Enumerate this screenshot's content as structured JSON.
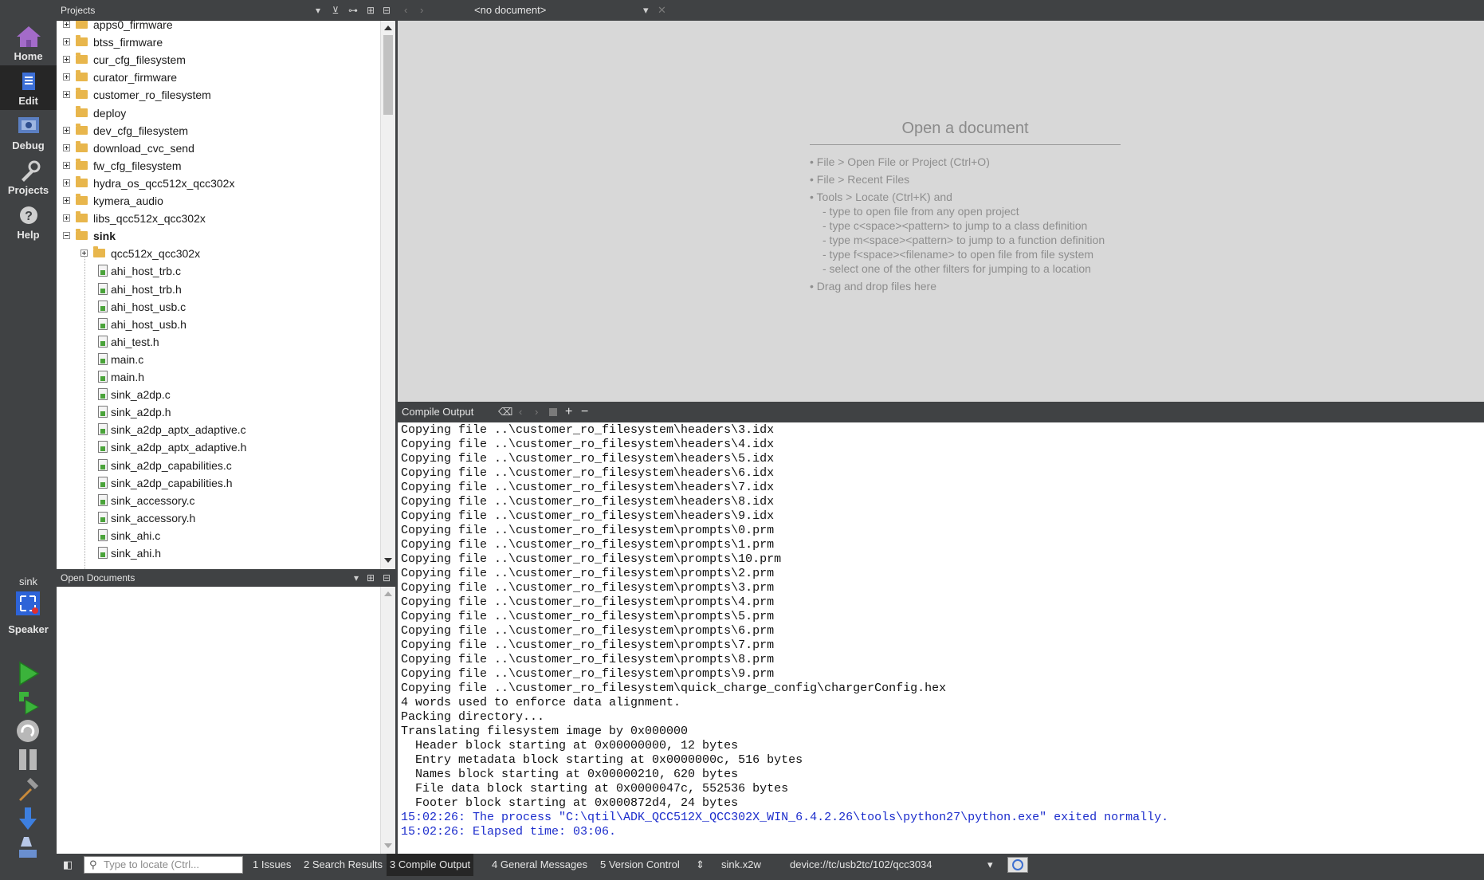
{
  "modes": [
    {
      "label": "Home",
      "icon": "home-icon"
    },
    {
      "label": "Edit",
      "icon": "edit-icon",
      "active": true
    },
    {
      "label": "Debug",
      "icon": "debug-icon"
    },
    {
      "label": "Projects",
      "icon": "wrench-icon"
    },
    {
      "label": "Help",
      "icon": "help-icon"
    }
  ],
  "kit": {
    "name": "sink",
    "type": "Speaker"
  },
  "projects_pane": {
    "title": "Projects",
    "tree": [
      {
        "name": "apps0_firmware",
        "kind": "folder",
        "expander": "plus"
      },
      {
        "name": "btss_firmware",
        "kind": "folder",
        "expander": "plus"
      },
      {
        "name": "cur_cfg_filesystem",
        "kind": "folder",
        "expander": "plus"
      },
      {
        "name": "curator_firmware",
        "kind": "folder",
        "expander": "plus"
      },
      {
        "name": "customer_ro_filesystem",
        "kind": "folder",
        "expander": "plus"
      },
      {
        "name": "deploy",
        "kind": "folder",
        "expander": "none"
      },
      {
        "name": "dev_cfg_filesystem",
        "kind": "folder",
        "expander": "plus"
      },
      {
        "name": "download_cvc_send",
        "kind": "folder",
        "expander": "plus"
      },
      {
        "name": "fw_cfg_filesystem",
        "kind": "folder",
        "expander": "plus"
      },
      {
        "name": "hydra_os_qcc512x_qcc302x",
        "kind": "folder",
        "expander": "plus"
      },
      {
        "name": "kymera_audio",
        "kind": "folder",
        "expander": "plus"
      },
      {
        "name": "libs_qcc512x_qcc302x",
        "kind": "folder",
        "expander": "plus"
      },
      {
        "name": "sink",
        "kind": "folder",
        "expander": "minus",
        "bold": true
      },
      {
        "name": "qcc512x_qcc302x",
        "kind": "folder",
        "expander": "plus",
        "child": true
      },
      {
        "name": "ahi_host_trb.c",
        "kind": "file",
        "child": true
      },
      {
        "name": "ahi_host_trb.h",
        "kind": "file",
        "child": true
      },
      {
        "name": "ahi_host_usb.c",
        "kind": "file",
        "child": true
      },
      {
        "name": "ahi_host_usb.h",
        "kind": "file",
        "child": true
      },
      {
        "name": "ahi_test.h",
        "kind": "file",
        "child": true
      },
      {
        "name": "main.c",
        "kind": "file",
        "child": true
      },
      {
        "name": "main.h",
        "kind": "file",
        "child": true
      },
      {
        "name": "sink_a2dp.c",
        "kind": "file",
        "child": true
      },
      {
        "name": "sink_a2dp.h",
        "kind": "file",
        "child": true
      },
      {
        "name": "sink_a2dp_aptx_adaptive.c",
        "kind": "file",
        "child": true
      },
      {
        "name": "sink_a2dp_aptx_adaptive.h",
        "kind": "file",
        "child": true
      },
      {
        "name": "sink_a2dp_capabilities.c",
        "kind": "file",
        "child": true
      },
      {
        "name": "sink_a2dp_capabilities.h",
        "kind": "file",
        "child": true
      },
      {
        "name": "sink_accessory.c",
        "kind": "file",
        "child": true
      },
      {
        "name": "sink_accessory.h",
        "kind": "file",
        "child": true
      },
      {
        "name": "sink_ahi.c",
        "kind": "file",
        "child": true
      },
      {
        "name": "sink_ahi.h",
        "kind": "file",
        "child": true
      }
    ]
  },
  "open_documents": {
    "title": "Open Documents"
  },
  "editor": {
    "document_selector": "<no document>",
    "open_panel": {
      "title": "Open a document",
      "lines": [
        "• File > Open File or Project (Ctrl+O)",
        "• File > Recent Files",
        "• Tools > Locate (Ctrl+K) and",
        "- type to open file from any open project",
        "- type c<space><pattern> to jump to a class definition",
        "- type m<space><pattern> to jump to a function definition",
        "- type f<space><filename> to open file from file system",
        "- select one of the other filters for jumping to a location",
        "• Drag and drop files here"
      ]
    }
  },
  "compile_output": {
    "title": "Compile Output",
    "lines": [
      "Copying file ..\\customer_ro_filesystem\\headers\\3.idx",
      "Copying file ..\\customer_ro_filesystem\\headers\\4.idx",
      "Copying file ..\\customer_ro_filesystem\\headers\\5.idx",
      "Copying file ..\\customer_ro_filesystem\\headers\\6.idx",
      "Copying file ..\\customer_ro_filesystem\\headers\\7.idx",
      "Copying file ..\\customer_ro_filesystem\\headers\\8.idx",
      "Copying file ..\\customer_ro_filesystem\\headers\\9.idx",
      "Copying file ..\\customer_ro_filesystem\\prompts\\0.prm",
      "Copying file ..\\customer_ro_filesystem\\prompts\\1.prm",
      "Copying file ..\\customer_ro_filesystem\\prompts\\10.prm",
      "Copying file ..\\customer_ro_filesystem\\prompts\\2.prm",
      "Copying file ..\\customer_ro_filesystem\\prompts\\3.prm",
      "Copying file ..\\customer_ro_filesystem\\prompts\\4.prm",
      "Copying file ..\\customer_ro_filesystem\\prompts\\5.prm",
      "Copying file ..\\customer_ro_filesystem\\prompts\\6.prm",
      "Copying file ..\\customer_ro_filesystem\\prompts\\7.prm",
      "Copying file ..\\customer_ro_filesystem\\prompts\\8.prm",
      "Copying file ..\\customer_ro_filesystem\\prompts\\9.prm",
      "Copying file ..\\customer_ro_filesystem\\quick_charge_config\\chargerConfig.hex",
      "4 words used to enforce data alignment.",
      "Packing directory...",
      "Translating filesystem image by 0x000000",
      "  Header block starting at 0x00000000, 12 bytes",
      "  Entry metadata block starting at 0x0000000c, 516 bytes",
      "  Names block starting at 0x00000210, 620 bytes",
      "  File data block starting at 0x0000047c, 552536 bytes",
      "  Footer block starting at 0x000872d4, 24 bytes"
    ],
    "status_lines": [
      "15:02:26: The process \"C:\\qtil\\ADK_QCC512X_QCC302X_WIN_6.4.2.26\\tools\\python27\\python.exe\" exited normally.",
      "15:02:26: Elapsed time: 03:06."
    ]
  },
  "statusbar": {
    "locator_placeholder": "Type to locate (Ctrl...",
    "tabs": [
      "1  Issues",
      "2  Search Results",
      "3  Compile Output",
      "4  General Messages",
      "5  Version Control"
    ],
    "active_tab": 2,
    "file": "sink.x2w",
    "device": "device://tc/usb2tc/102/qcc3034"
  },
  "colors": {
    "chrome": "#404244",
    "active_mode": "#262626",
    "editor_bg": "#d8d8d8",
    "status_text": "#1b2ccc",
    "run_green": "#3bb33b"
  }
}
